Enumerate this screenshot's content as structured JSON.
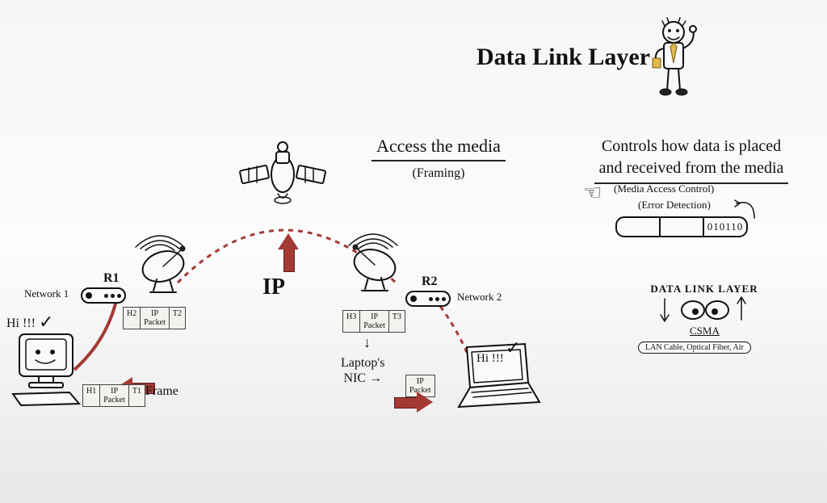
{
  "title": "Data Link Layer",
  "access": {
    "heading": "Access the media",
    "sub": "(Framing)"
  },
  "controls": {
    "line1": "Controls how data is placed",
    "line2": "and received from the media",
    "mac": "(Media Access Control)",
    "err": "(Error Detection)",
    "bits": "010110"
  },
  "medium": {
    "heading": "DATA LINK LAYER",
    "sublayer": "CSMA",
    "media_list": "LAN Cable, Optical Fiber, Air"
  },
  "ip_label": "IP",
  "network1": "Network 1",
  "network2": "Network 2",
  "r1": "R1",
  "r2": "R2",
  "hi1": "Hi !!!",
  "hi2": "Hi !!!",
  "laptop_nic_line1": "Laptop's",
  "laptop_nic_line2": "NIC",
  "frame_label": "Frame",
  "frames": {
    "f1": {
      "h": "H1",
      "p": "IP\nPacket",
      "t": "T1"
    },
    "f2": {
      "h": "H2",
      "p": "IP\nPacket",
      "t": "T2"
    },
    "f3": {
      "h": "H3",
      "p": "IP\nPacket",
      "t": "T3"
    },
    "packet_only": "IP\nPacket"
  }
}
